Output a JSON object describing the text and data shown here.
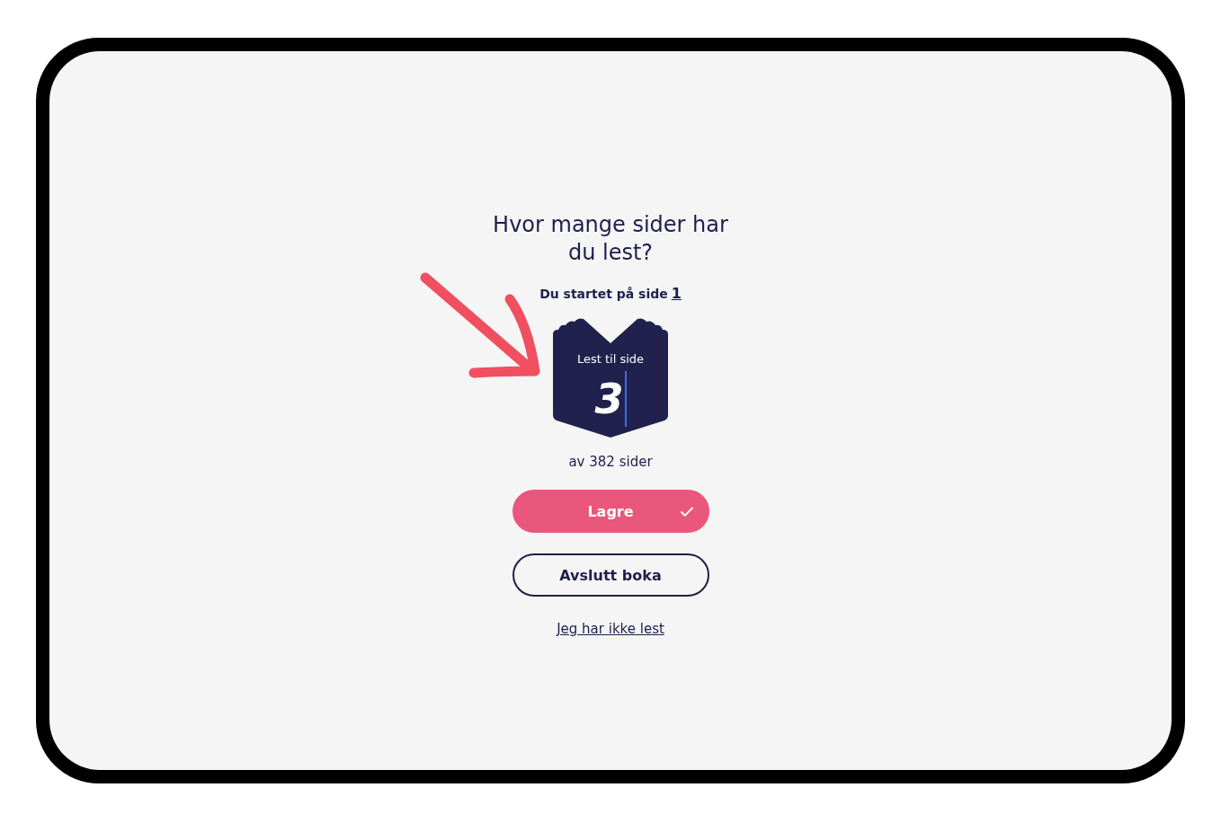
{
  "heading": "Hvor mange sider har du lest?",
  "start": {
    "label": "Du startet på side",
    "page": "1"
  },
  "book": {
    "label": "Lest til side",
    "value": "3"
  },
  "total": "av 382 sider",
  "buttons": [
    {
      "label": "Lagre",
      "kind": "primary"
    },
    {
      "label": "Avslutt boka",
      "kind": "secondary"
    }
  ],
  "link": "Jeg har ikke lest"
}
